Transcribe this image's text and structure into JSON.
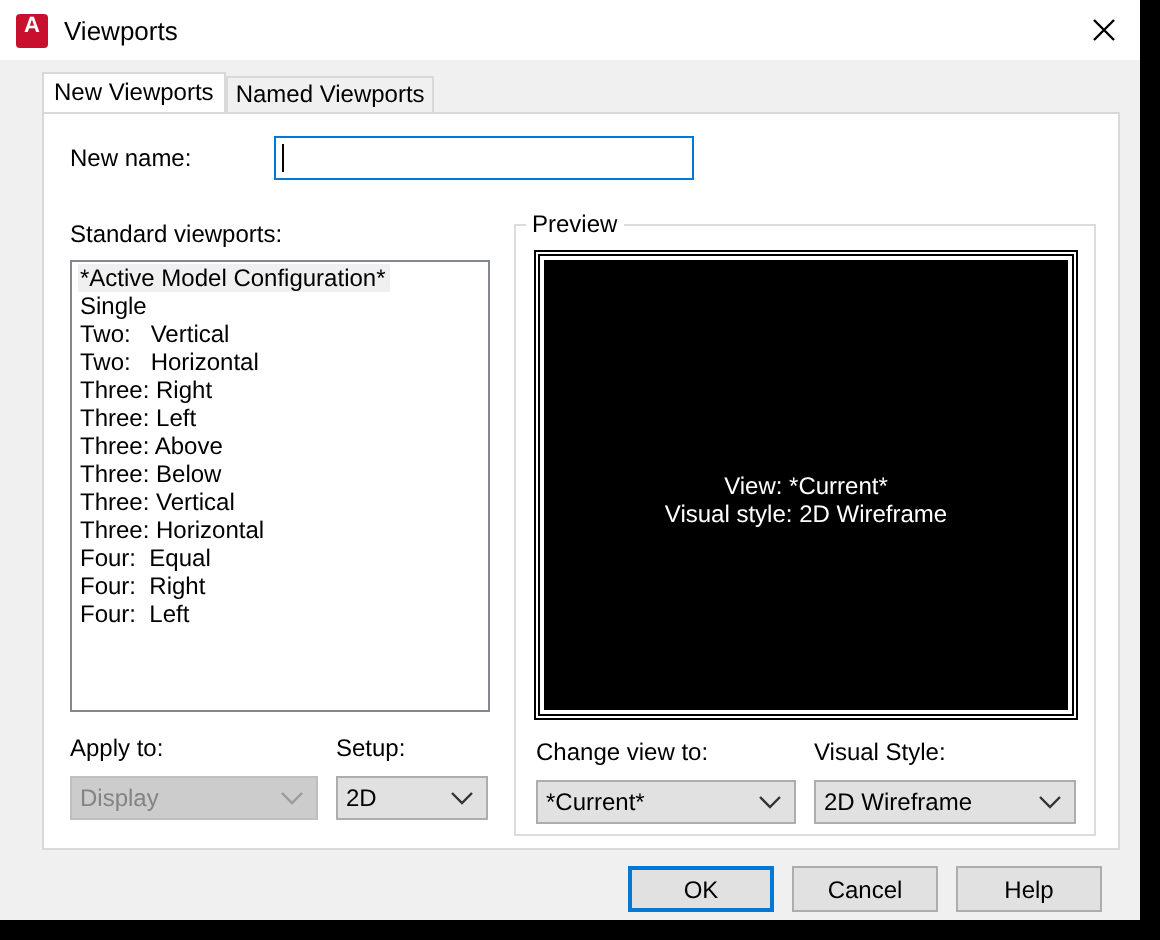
{
  "window": {
    "title": "Viewports",
    "app_icon_letter": "A"
  },
  "tabs": [
    {
      "label": "New Viewports",
      "selected": true
    },
    {
      "label": "Named Viewports",
      "selected": false
    }
  ],
  "new_name": {
    "label": "New name:",
    "focused": true
  },
  "standard_viewports": {
    "label": "Standard viewports:",
    "items": [
      {
        "label": "*Active Model Configuration*",
        "selected": true
      },
      {
        "label": "Single",
        "selected": false
      },
      {
        "label": "Two:   Vertical",
        "selected": false
      },
      {
        "label": "Two:   Horizontal",
        "selected": false
      },
      {
        "label": "Three: Right",
        "selected": false
      },
      {
        "label": "Three: Left",
        "selected": false
      },
      {
        "label": "Three: Above",
        "selected": false
      },
      {
        "label": "Three: Below",
        "selected": false
      },
      {
        "label": "Three: Vertical",
        "selected": false
      },
      {
        "label": "Three: Horizontal",
        "selected": false
      },
      {
        "label": "Four:  Equal",
        "selected": false
      },
      {
        "label": "Four:  Right",
        "selected": false
      },
      {
        "label": "Four:  Left",
        "selected": false
      }
    ]
  },
  "preview": {
    "title": "Preview",
    "lines": [
      "View: *Current*",
      "Visual style: 2D Wireframe"
    ]
  },
  "left_combos": [
    {
      "label": "Apply to:",
      "value": "Display",
      "disabled": true
    },
    {
      "label": "Setup:",
      "value": "2D",
      "disabled": false
    }
  ],
  "preview_combos": [
    {
      "label": "Change view to:",
      "value": "*Current*",
      "disabled": false
    },
    {
      "label": "Visual Style:",
      "value": "2D Wireframe",
      "disabled": false
    }
  ],
  "buttons": [
    {
      "label": "OK",
      "default": true
    },
    {
      "label": "Cancel",
      "default": false
    },
    {
      "label": "Help",
      "default": false
    }
  ]
}
